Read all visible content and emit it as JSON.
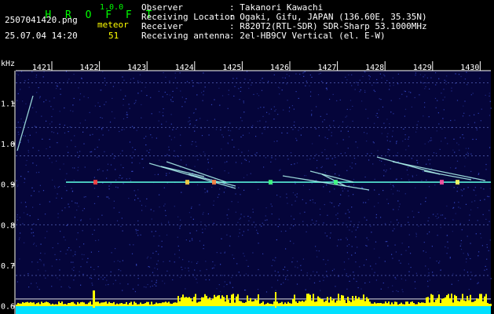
{
  "app": {
    "name": "H R O F F T",
    "version": "1.0.0"
  },
  "capture": {
    "file": "2507041420.png",
    "datetime": "25.07.04 14:20",
    "type": "meteor",
    "count": "51"
  },
  "info": {
    "rows": [
      {
        "label": "Observer",
        "value": ": Takanori Kawachi"
      },
      {
        "label": "Receiving Location",
        "value": ": Ogaki, Gifu, JAPAN (136.60E, 35.35N)"
      },
      {
        "label": "Receiver",
        "value": ": R820T2(RTL-SDR) SDR-Sharp 53.1000MHz"
      },
      {
        "label": "Receiving antenna",
        "value": ": 2el-HB9CV Vertical (el. E-W)"
      }
    ]
  },
  "chart_data": {
    "type": "heatmap",
    "ylabel": "kHz",
    "x_ticks": [
      "1421",
      "1422",
      "1423",
      "1424",
      "1425",
      "1426",
      "1427",
      "1428",
      "1429",
      "1430"
    ],
    "y_ticks": [
      "1.1",
      "1.0",
      "0.9",
      "0.8",
      "0.7",
      "0.6"
    ],
    "ylim": [
      0.58,
      1.18
    ],
    "carrier_khz": 0.905,
    "colors": {
      "background": "#05053a",
      "noise": "#3a4fd0",
      "carrier": "#58f0d8",
      "trace": "#b0f8f0",
      "bar": "#ffff00",
      "baseline": "#00e0ff"
    }
  }
}
